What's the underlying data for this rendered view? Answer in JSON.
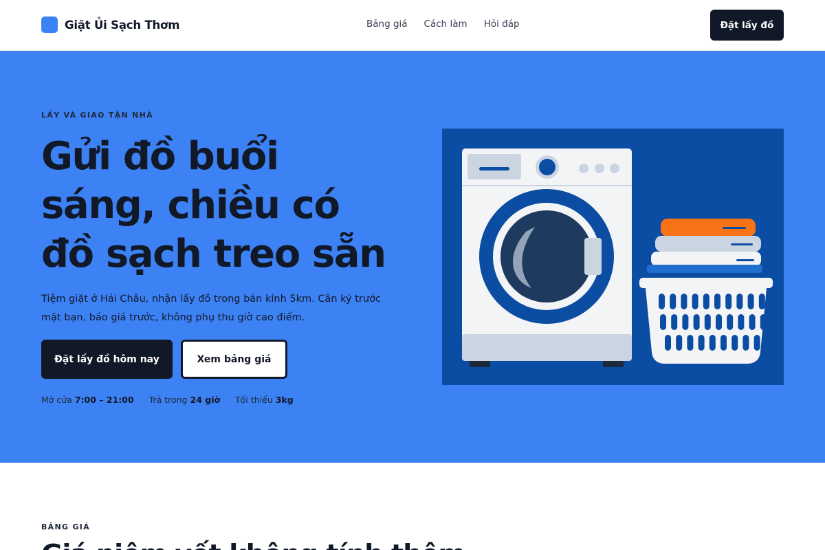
{
  "brand": {
    "name": "Giặt Ủi Sạch Thơm",
    "color": "#3b82f6"
  },
  "nav": {
    "items": [
      "Bảng giá",
      "Cách làm",
      "Hỏi đáp"
    ]
  },
  "header": {
    "cta": "Đặt lấy đồ"
  },
  "hero": {
    "eyebrow": "LẤY VÀ GIAO TẬN NHÀ",
    "headline": "Gửi đồ buổi sáng, chiều có đồ sạch treo sẵn",
    "lede": "Tiệm giặt ở Hải Châu, nhận lấy đồ trong bán kính 5km. Cân ký trước mặt bạn, báo giá trước, không phụ thu giờ cao điểm.",
    "primary_cta": "Đặt lấy đồ hôm nay",
    "secondary_cta": "Xem bảng giá",
    "facts": [
      {
        "label": "Mở cửa",
        "value": "7:00 – 21:00"
      },
      {
        "label": "Trả trong",
        "value": "24 giờ"
      },
      {
        "label": "Tối thiểu",
        "value": "3kg"
      }
    ],
    "background": "#3c82f4",
    "illustration_icon": "washing-machine-and-laundry-basket"
  },
  "pricing": {
    "eyebrow": "BẢNG GIÁ",
    "title": "Giá niêm yết không tính thêm"
  }
}
